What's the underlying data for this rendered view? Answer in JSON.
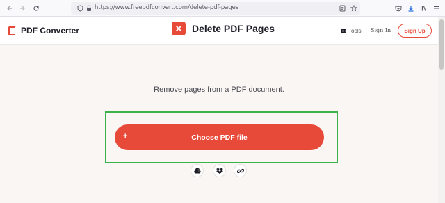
{
  "browser": {
    "url": "https://www.freepdfconvert.com/delete-pdf-pages",
    "back_icon": "arrow-left-icon",
    "forward_icon": "arrow-right-icon",
    "reload_icon": "reload-icon"
  },
  "header": {
    "logo_text": "PDF Converter",
    "title": "Delete PDF Pages",
    "title_icon": "x-icon",
    "tools_label": "Tools",
    "signin_label": "Sign In",
    "signup_label": "Sign Up"
  },
  "main": {
    "subtitle": "Remove pages from a PDF document.",
    "choose_plus": "+",
    "choose_label": "Choose PDF file",
    "sources": [
      "google-drive-icon",
      "dropbox-icon",
      "link-icon"
    ]
  },
  "colors": {
    "accent": "#e84a3a",
    "highlight": "#3bb34a",
    "background": "#faf6f4"
  }
}
